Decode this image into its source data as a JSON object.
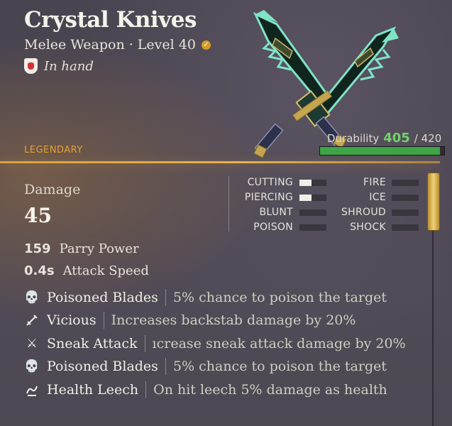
{
  "item": {
    "name": "Crystal Knives",
    "subtitle": "Melee Weapon · Level 40",
    "equip_status": "In hand",
    "rarity": "LEGENDARY"
  },
  "durability": {
    "label": "Durability",
    "current": "405",
    "max": "/ 420",
    "fraction": 0.964
  },
  "damage": {
    "label": "Damage",
    "value": "45",
    "types_left": [
      {
        "name": "CUTTING",
        "fill": 0.45
      },
      {
        "name": "PIERCING",
        "fill": 0.45
      },
      {
        "name": "BLUNT",
        "fill": 0
      },
      {
        "name": "POISON",
        "fill": 0
      }
    ],
    "types_right": [
      {
        "name": "FIRE",
        "fill": 0
      },
      {
        "name": "ICE",
        "fill": 0
      },
      {
        "name": "SHROUD",
        "fill": 0
      },
      {
        "name": "SHOCK",
        "fill": 0
      }
    ]
  },
  "stats": [
    {
      "value": "159",
      "label": "Parry Power"
    },
    {
      "value": "0.4s",
      "label": "Attack Speed"
    }
  ],
  "perks": [
    {
      "icon": "skull-icon",
      "name": "Poisoned Blades",
      "desc": "5% chance to poison the target"
    },
    {
      "icon": "backstab-icon",
      "name": "Vicious",
      "desc": "Increases backstab damage by 20%"
    },
    {
      "icon": "crossed-swords-icon",
      "name": "Sneak Attack",
      "desc": "ıcrease sneak attack damage by 20%"
    },
    {
      "icon": "skull-icon",
      "name": "Poisoned Blades",
      "desc": "5% chance to poison the target"
    },
    {
      "icon": "leech-icon",
      "name": "Health Leech",
      "desc": "On hit leech 5% damage as health"
    }
  ],
  "colors": {
    "rarity": "#e2a22c",
    "durability_value": "#6fd36a",
    "durability_bar": "#3fa548"
  }
}
